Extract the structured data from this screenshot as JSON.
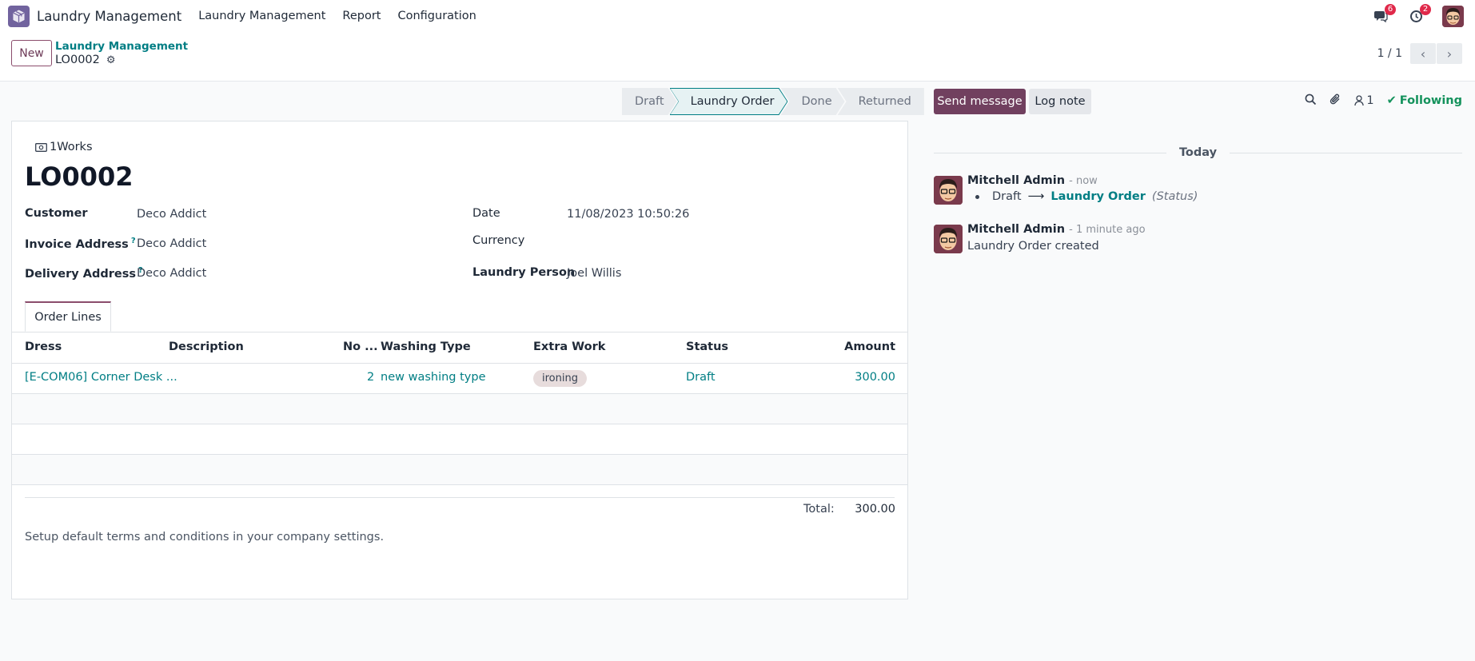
{
  "topnav": {
    "app_name": "Laundry Management",
    "menus": [
      "Laundry Management",
      "Report",
      "Configuration"
    ],
    "messages_badge": "6",
    "activities_badge": "2"
  },
  "control": {
    "new_label": "New",
    "breadcrumb_parent": "Laundry Management",
    "breadcrumb_current": "LO0002",
    "pager_value": "1 / 1"
  },
  "statusbar": {
    "stages": [
      "Draft",
      "Laundry Order",
      "Done",
      "Returned"
    ],
    "active_stage": "Laundry Order"
  },
  "form": {
    "company": "1Works",
    "record_name": "LO0002",
    "fields": {
      "customer_label": "Customer",
      "customer_value": "Deco Addict",
      "invoice_label": "Invoice Address",
      "invoice_value": "Deco Addict",
      "delivery_label": "Delivery Address",
      "delivery_value": "Deco Addict",
      "help_marker": "?",
      "date_label": "Date",
      "date_value": "11/08/2023 10:50:26",
      "currency_label": "Currency",
      "currency_value": "",
      "laundry_person_label": "Laundry Person",
      "laundry_person_value": "Joel Willis"
    },
    "tab_label": "Order Lines",
    "table": {
      "headers": [
        "Dress",
        "Description",
        "No ...",
        "Washing Type",
        "Extra Work",
        "Status",
        "Amount"
      ],
      "rows": [
        {
          "dress": "[E-COM06] Corner Desk ...",
          "description": "",
          "number": "2",
          "washing_type": "new washing type",
          "extra_work": "ironing",
          "status": "Draft",
          "amount": "300.00"
        }
      ]
    },
    "total_label": "Total:",
    "total_value": "300.00",
    "terms": "Setup default terms and conditions in your company settings."
  },
  "chatter": {
    "send_message": "Send message",
    "log_note": "Log note",
    "followers_count": "1",
    "following_label": "Following",
    "date_separator": "Today",
    "messages": [
      {
        "author": "Mitchell Admin",
        "date": "- now",
        "old_value": "Draft",
        "new_value": "Laundry Order",
        "field": "(Status)"
      },
      {
        "author": "Mitchell Admin",
        "date": "- 1 minute ago",
        "body": "Laundry Order created"
      }
    ]
  },
  "colors": {
    "brand": "#71405f",
    "link": "#017e84",
    "following": "#14925c",
    "badge": "#e0294a"
  }
}
